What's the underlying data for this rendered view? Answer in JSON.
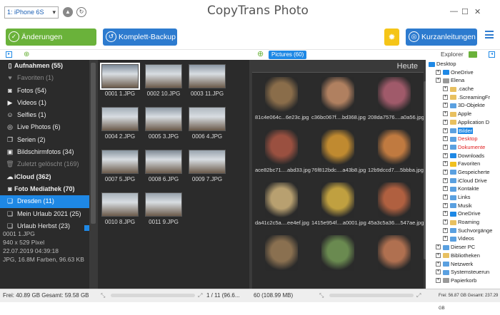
{
  "device_selector": "1: iPhone 6S",
  "app_title": "CopyTrans Photo",
  "toolbar": {
    "save_label": "Änderungen speichern",
    "backup_label": "Komplett-Backup",
    "guide_label": "Kurzanleitungen"
  },
  "sidebar": {
    "items": [
      {
        "label": "Aufnahmen (55)",
        "type": "head",
        "icon": "phone-icon"
      },
      {
        "label": "Favoriten (1)",
        "type": "dim",
        "icon": "heart-icon"
      },
      {
        "label": "Fotos (54)",
        "type": "normal",
        "icon": "camera-icon"
      },
      {
        "label": "Videos (1)",
        "type": "normal",
        "icon": "video-icon"
      },
      {
        "label": "Selfies (1)",
        "type": "normal",
        "icon": "user-icon"
      },
      {
        "label": "Live Photos (6)",
        "type": "normal",
        "icon": "live-photo-icon"
      },
      {
        "label": "Serien (2)",
        "type": "normal",
        "icon": "burst-icon"
      },
      {
        "label": "Bildschirmfotos (34)",
        "type": "normal",
        "icon": "screenshot-icon"
      },
      {
        "label": "Zuletzt gelöscht (169)",
        "type": "dim",
        "icon": "trash-icon"
      },
      {
        "label": "iCloud (362)",
        "type": "head",
        "icon": "cloud-icon"
      },
      {
        "label": "Foto Mediathek (70)",
        "type": "head",
        "icon": "camera-icon"
      },
      {
        "label": "Dresden (11)",
        "type": "sel",
        "icon": "album-icon"
      },
      {
        "label": "Mein Urlaub 2021 (25)",
        "type": "normal",
        "icon": "album-icon"
      },
      {
        "label": "Urlaub Herbst (23)",
        "type": "normal",
        "icon": "album-icon"
      }
    ],
    "info": {
      "name": "0001 1.JPG",
      "size": "940 x 529 Pixel",
      "date": "22.07.2019 04:39:18",
      "format": "JPG, 16.8M Farben, 96.63 KB"
    }
  },
  "album_thumbs": [
    {
      "label": "0001 1.JPG",
      "selected": true
    },
    {
      "label": "0002 10.JPG"
    },
    {
      "label": "0003 11.JPG"
    },
    {
      "label": "0004 2.JPG"
    },
    {
      "label": "0005 3.JPG"
    },
    {
      "label": "0006 4.JPG"
    },
    {
      "label": "0007 5.JPG"
    },
    {
      "label": "0008 6.JPG"
    },
    {
      "label": "0009 7.JPG"
    },
    {
      "label": "0010 8.JPG"
    },
    {
      "label": "0011 9.JPG"
    }
  ],
  "pictures_pill": "Pictures (60)",
  "pictures_header": "Heute",
  "pictures": [
    {
      "label": "81c4e064c...6e23c.jpg",
      "color": "#8a6d4a"
    },
    {
      "label": "c36bc067f....bd368.jpg",
      "color": "#b08060"
    },
    {
      "label": "208da7576....a0a56.jpg",
      "color": "#a05a6a"
    },
    {
      "label": "ace82bc71....abd33.jpg",
      "color": "#9a5040"
    },
    {
      "label": "76f812bdc....a43b8.jpg",
      "color": "#c08a30"
    },
    {
      "label": "12b9dccd7....5bbba.jpg",
      "color": "#c07a40"
    },
    {
      "label": "da41c2c5a....ee4ef.jpg",
      "color": "#b8a070"
    },
    {
      "label": "1415e954f....a0001.jpg",
      "color": "#c0a040"
    },
    {
      "label": "45a3c5a36....547ae.jpg",
      "color": "#b06040"
    },
    {
      "label": "",
      "color": "#8a7050"
    },
    {
      "label": "",
      "color": "#6a8a50"
    },
    {
      "label": "",
      "color": "#b07050"
    }
  ],
  "explorer": {
    "title": "Explorer",
    "tree": [
      {
        "label": "Desktop",
        "indent": 0,
        "color": "#1e88e5"
      },
      {
        "label": "OneDrive",
        "indent": 1,
        "color": "#1e88e5"
      },
      {
        "label": "Elena",
        "indent": 1,
        "color": "#999"
      },
      {
        "label": ".cache",
        "indent": 2,
        "color": "#e8c060"
      },
      {
        "label": ".ScreamingFr",
        "indent": 2,
        "color": "#e8c060"
      },
      {
        "label": "3D-Objekte",
        "indent": 2,
        "color": "#5aa0e0"
      },
      {
        "label": "Apple",
        "indent": 2,
        "color": "#e8c060"
      },
      {
        "label": "Application D",
        "indent": 2,
        "color": "#e8c060"
      },
      {
        "label": "Bilder",
        "indent": 2,
        "color": "#5aa0e0",
        "state": "sel"
      },
      {
        "label": "Desktop",
        "indent": 2,
        "color": "#5aa0e0",
        "state": "red"
      },
      {
        "label": "Dokumente",
        "indent": 2,
        "color": "#5aa0e0",
        "state": "red"
      },
      {
        "label": "Downloads",
        "indent": 2,
        "color": "#1e88e5"
      },
      {
        "label": "Favoriten",
        "indent": 2,
        "color": "#f0c020"
      },
      {
        "label": "Gespeicherte",
        "indent": 2,
        "color": "#5aa0e0"
      },
      {
        "label": "iCloud Drive",
        "indent": 2,
        "color": "#5aa0e0"
      },
      {
        "label": "Kontakte",
        "indent": 2,
        "color": "#5aa0e0"
      },
      {
        "label": "Links",
        "indent": 2,
        "color": "#5aa0e0"
      },
      {
        "label": "Musik",
        "indent": 2,
        "color": "#5aa0e0"
      },
      {
        "label": "OneDrive",
        "indent": 2,
        "color": "#1e88e5"
      },
      {
        "label": "Roaming",
        "indent": 2,
        "color": "#e8c060"
      },
      {
        "label": "Suchvorgänge",
        "indent": 2,
        "color": "#5aa0e0"
      },
      {
        "label": "Videos",
        "indent": 2,
        "color": "#5aa0e0"
      },
      {
        "label": "Dieser PC",
        "indent": 1,
        "color": "#5aa0e0"
      },
      {
        "label": "Bibliotheken",
        "indent": 1,
        "color": "#e8c060"
      },
      {
        "label": "Netzwerk",
        "indent": 1,
        "color": "#5aa0e0"
      },
      {
        "label": "Systemsteuerun",
        "indent": 1,
        "color": "#5aa0e0"
      },
      {
        "label": "Papierkorb",
        "indent": 1,
        "color": "#999"
      }
    ]
  },
  "status": {
    "left": "Frei: 40.89 GB Gesamt: 59.58 GB",
    "album_count": "1 / 11 (96.6...",
    "pictures_count": "60 (108.99 MB)",
    "explorer": "Frei: 56.87 GB Gesamt: 237.29 GB"
  },
  "colors": {
    "accent": "#1e88e5",
    "green": "#6ab23a",
    "blue": "#2d7bcf",
    "panel": "#2b2b2b"
  }
}
